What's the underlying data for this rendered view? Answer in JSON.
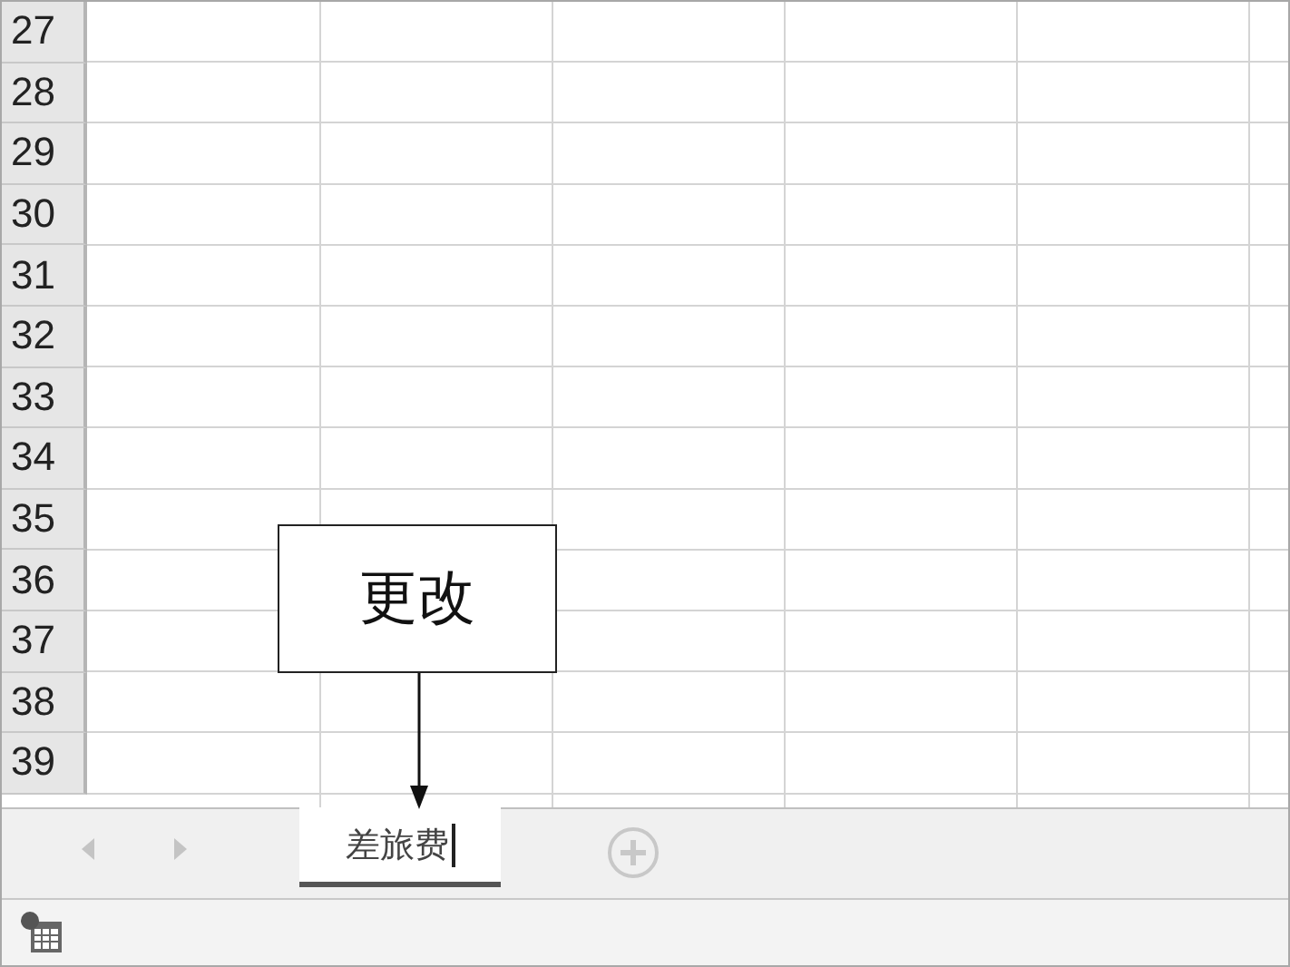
{
  "rows": [
    "27",
    "28",
    "29",
    "30",
    "31",
    "32",
    "33",
    "34",
    "35",
    "36",
    "37",
    "38",
    "39"
  ],
  "sheet_tabs": [
    {
      "label": "差旅费",
      "selected": true,
      "editing": true
    }
  ],
  "callout": {
    "text": "更改"
  }
}
